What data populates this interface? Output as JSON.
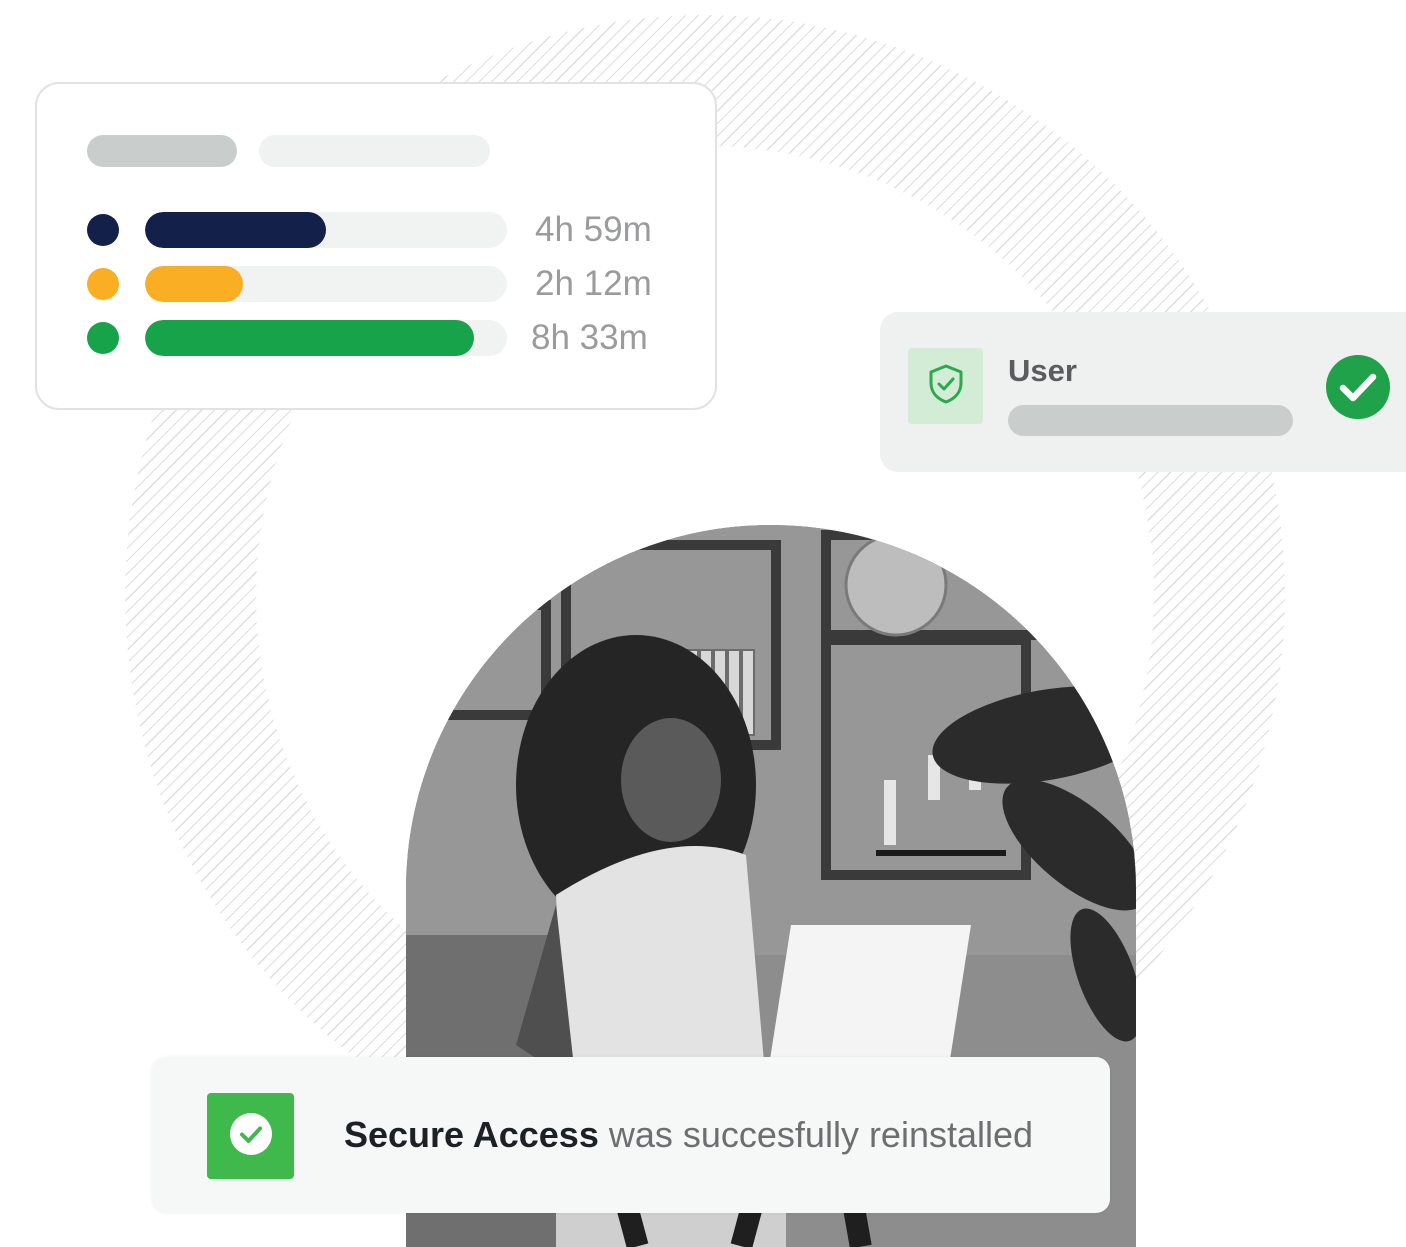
{
  "time_card": {
    "rows": [
      {
        "duration": "4h 59m",
        "fill_fraction": 0.5,
        "color": "#13204a"
      },
      {
        "duration": "2h 12m",
        "fill_fraction": 0.27,
        "color": "#f9ae24"
      },
      {
        "duration": "8h 33m",
        "fill_fraction": 0.91,
        "color": "#17a34a"
      }
    ]
  },
  "user_card": {
    "label": "User",
    "shield_icon": "shield-check-icon",
    "status_icon": "check-circle-icon",
    "accent": "#1fa24a"
  },
  "notification": {
    "app_name": "Secure Access",
    "message": " was succesfully reinstalled",
    "icon": "check-circle-icon",
    "icon_bg": "#3fb94c"
  }
}
